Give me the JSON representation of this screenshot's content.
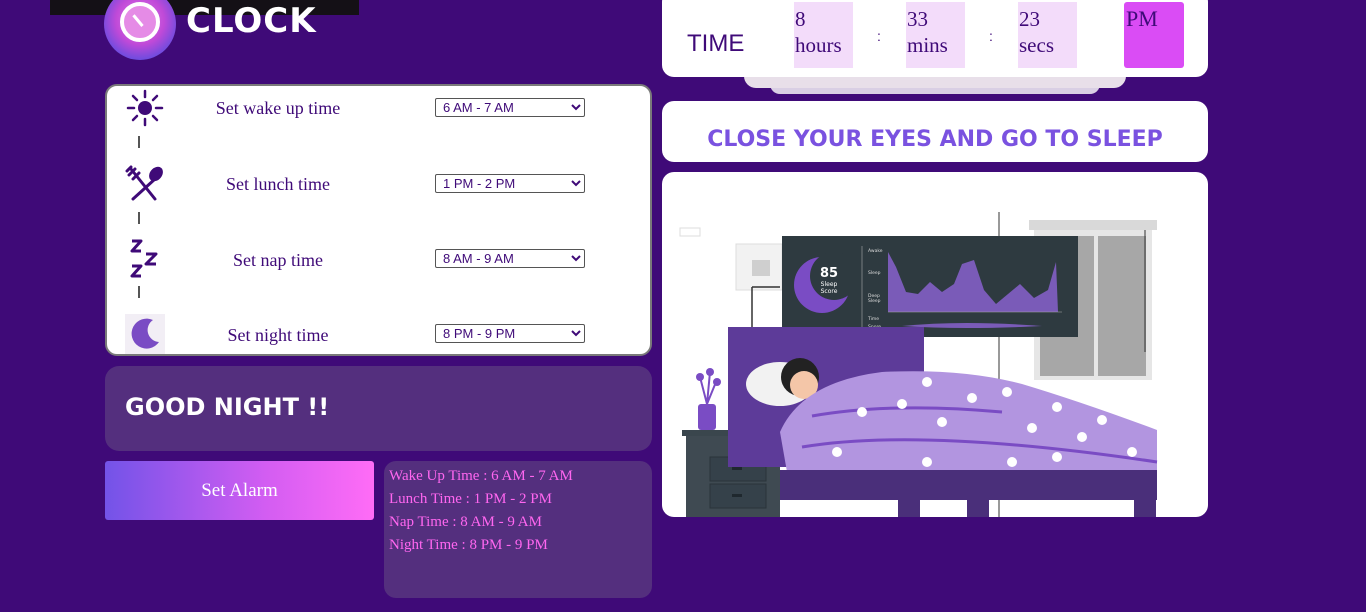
{
  "app": {
    "title": "CLOCK"
  },
  "routine": [
    {
      "label": "Set wake up time",
      "selected": "6 AM - 7 AM",
      "icon": "sun-icon"
    },
    {
      "label": "Set lunch time",
      "selected": "1 PM - 2 PM",
      "icon": "fork-spoon-icon"
    },
    {
      "label": "Set nap time",
      "selected": "8 AM - 9 AM",
      "icon": "zzz-icon"
    },
    {
      "label": "Set night time",
      "selected": "8 PM - 9 PM",
      "icon": "moon-icon"
    }
  ],
  "greeting": "GOOD NIGHT !!",
  "alarm_button": "Set Alarm",
  "summary": {
    "wake": "Wake Up Time : 6 AM - 7 AM",
    "lunch": "Lunch Time : 1 PM - 2 PM",
    "nap": "Nap Time : 8 AM - 9 AM",
    "night": "Night Time : 8 PM - 9 PM"
  },
  "clock": {
    "label": "TIME",
    "hours": "8",
    "hours_unit": "hours",
    "mins": "33",
    "mins_unit": "mins",
    "secs": "23",
    "secs_unit": "secs",
    "separator": ":",
    "ampm": "PM"
  },
  "message": "CLOSE YOUR EYES AND GO TO SLEEP",
  "illustration": {
    "score": "85",
    "score_label": "Sleep Score",
    "chart_labels": [
      "Awake",
      "Sleep",
      "Deep Sleep",
      "Time",
      "Snore"
    ]
  },
  "colors": {
    "background": "#3f0a78",
    "accent": "#da4cf5",
    "summary_text": "#ff66f0",
    "message_text": "#7a52e0"
  }
}
